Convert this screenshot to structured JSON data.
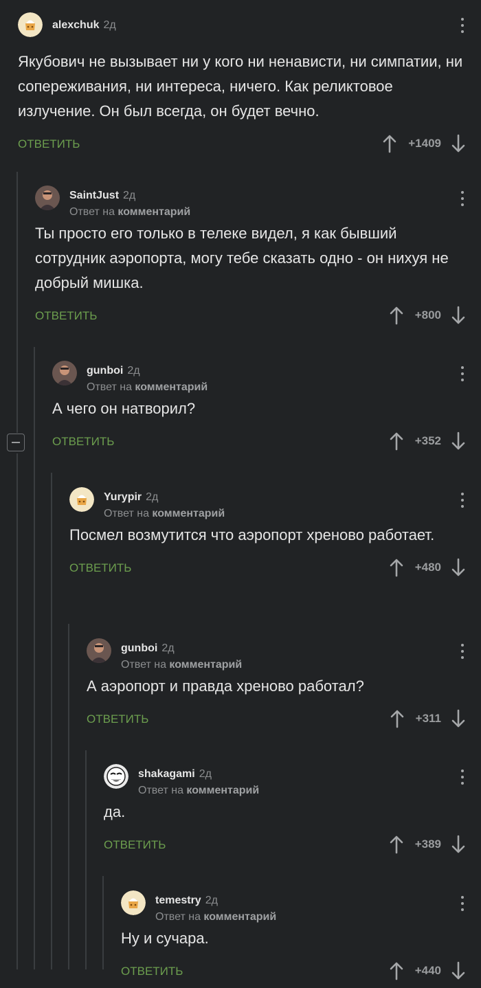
{
  "comments": [
    {
      "author": "alexchuk",
      "time": "2д",
      "reply_prefix": "",
      "reply_link": "",
      "text": "Якубович не вызывает ни у кого ни ненависти, ни симпатии, ни сопереживания, ни интереса,  ничего.  Как реликтовое излучение. Он был всегда,  он будет вечно.",
      "reply_label": "ОТВЕТИТЬ",
      "score": "+1409",
      "avatar": "default-avatar"
    },
    {
      "author": "SaintJust",
      "time": "2д",
      "reply_prefix": "Ответ на",
      "reply_link": "комментарий",
      "text": "Ты просто его только в телеке видел, я как бывший сотрудник аэропорта, могу тебе сказать одно - он нихуя не добрый мишка.",
      "reply_label": "ОТВЕТИТЬ",
      "score": "+800",
      "avatar": "photo-avatar"
    },
    {
      "author": "gunboi",
      "time": "2д",
      "reply_prefix": "Ответ на",
      "reply_link": "комментарий",
      "text": "А чего он натворил?",
      "reply_label": "ОТВЕТИТЬ",
      "score": "+352",
      "avatar": "photo-avatar"
    },
    {
      "author": "Yurypir",
      "time": "2д",
      "reply_prefix": "Ответ на",
      "reply_link": "комментарий",
      "text": "Посмел возмутится что аэропорт хреново работает.",
      "reply_label": "ОТВЕТИТЬ",
      "score": "+480",
      "avatar": "default-avatar"
    },
    {
      "author": "gunboi",
      "time": "2д",
      "reply_prefix": "Ответ на",
      "reply_link": "комментарий",
      "text": "А аэропорт и правда хреново работал?",
      "reply_label": "ОТВЕТИТЬ",
      "score": "+311",
      "avatar": "photo-avatar"
    },
    {
      "author": "shakagami",
      "time": "2д",
      "reply_prefix": "Ответ на",
      "reply_link": "комментарий",
      "text": "да.",
      "reply_label": "ОТВЕТИТЬ",
      "score": "+389",
      "avatar": "meme-face-avatar"
    },
    {
      "author": "temestry",
      "time": "2д",
      "reply_prefix": "Ответ на",
      "reply_link": "комментарий",
      "text": "Ну и сучара.",
      "reply_label": "ОТВЕТИТЬ",
      "score": "+440",
      "avatar": "default-avatar"
    }
  ],
  "colors": {
    "background": "#212325",
    "reply_green": "#6c9e4e",
    "muted_text": "#8c8e90",
    "thread_line": "#3a3d40"
  }
}
